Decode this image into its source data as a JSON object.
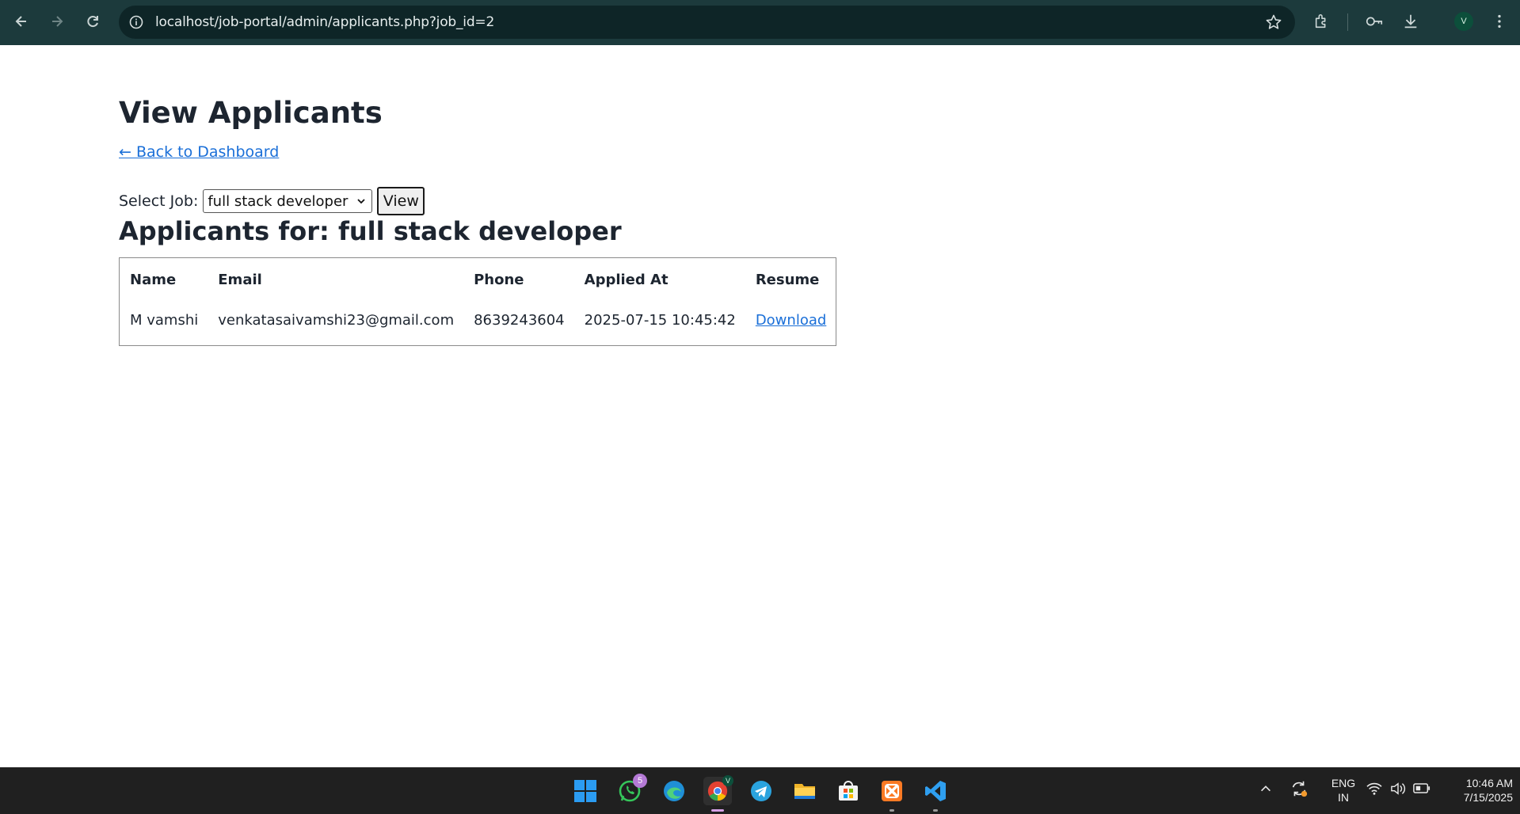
{
  "browser": {
    "url": "localhost/job-portal/admin/applicants.php?job_id=2",
    "profile_initial": "V"
  },
  "page": {
    "title": "View Applicants",
    "back_link": "← Back to Dashboard",
    "filter": {
      "label": "Select Job:",
      "selected_job": "full stack developer",
      "view_button": "View"
    },
    "subtitle": "Applicants for: full stack developer",
    "table": {
      "headers": [
        "Name",
        "Email",
        "Phone",
        "Applied At",
        "Resume"
      ],
      "rows": [
        {
          "name": "M vamshi",
          "email": "venkatasaivamshi23@gmail.com",
          "phone": "8639243604",
          "applied_at": "2025-07-15 10:45:42",
          "resume": "Download"
        }
      ]
    }
  },
  "taskbar": {
    "whatsapp_badge": "5",
    "chrome_profile": "V",
    "lang_line1": "ENG",
    "lang_line2": "IN",
    "time": "10:46 AM",
    "date": "7/15/2025"
  },
  "colors": {
    "chrome_bg": "#1c3a3c",
    "link": "#1a6fd8",
    "taskbar_bg": "#202020"
  }
}
